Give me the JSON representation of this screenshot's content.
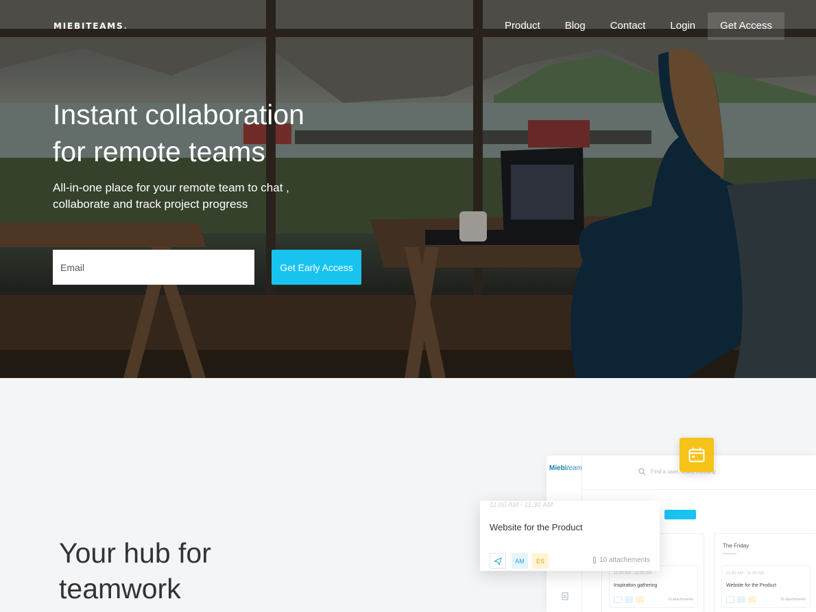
{
  "nav": {
    "logo": "MIEBITEAMS",
    "logo_dot": ".",
    "links": [
      "Product",
      "Blog",
      "Contact",
      "Login"
    ],
    "cta": "Get Access"
  },
  "hero": {
    "headline_line1": "Instant collaboration",
    "headline_line2": "for remote teams",
    "sub_line1": "All-in-one place for your remote team to chat ,",
    "sub_line2": "collaborate and track project progress",
    "email_placeholder": "Email",
    "cta": "Get Early Access"
  },
  "section": {
    "title_line1": "Your hub for",
    "title_line2": "teamwork"
  },
  "mockup": {
    "brand_bold": "Miebi",
    "brand_rest": "team",
    "search_placeholder": "Find a user, team, meeting ..",
    "col1_title": "",
    "col2_title": "The Friday",
    "col1_card_title": "Inspiration gathering",
    "col2_card_title": "Website for the Product",
    "card_tiny": "11:00 AM - 11:30 AM",
    "card_attach": "10 attachements",
    "event": {
      "time": "11:00 AM - 11:30 AM",
      "title": "Website for the Product",
      "initials_1": "AM",
      "initials_2": "ES",
      "attachments": "10 attachements"
    }
  },
  "colors": {
    "accent_blue": "#19c3f0",
    "badge_yellow": "#f7c318"
  },
  "icons": [
    "calendar-icon",
    "send-icon",
    "paperclip-icon",
    "search-icon",
    "document-icon"
  ]
}
